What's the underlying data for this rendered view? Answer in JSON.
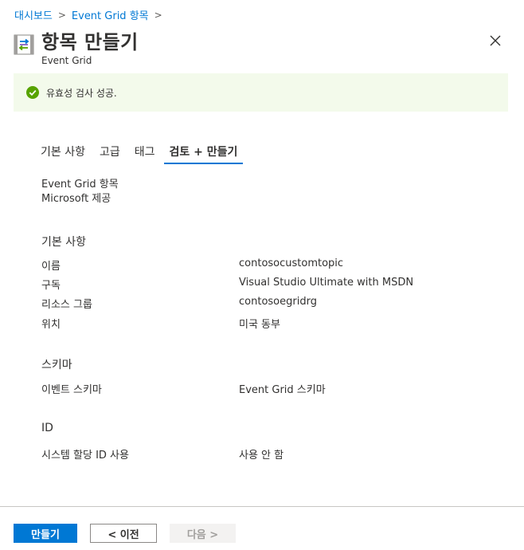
{
  "breadcrumb": {
    "items": [
      "대시보드",
      "Event Grid 항목"
    ],
    "separator": ">"
  },
  "header": {
    "title": "항목 만들기",
    "subtitle": "Event Grid",
    "icon": "event-grid-icon",
    "close_icon": "close-icon"
  },
  "banner": {
    "text": "유효성 검사 성공.",
    "icon": "success-check-icon",
    "color": "#57a300",
    "background": "#f3faeb"
  },
  "tabs": [
    {
      "label": "기본 사항",
      "active": false
    },
    {
      "label": "고급",
      "active": false
    },
    {
      "label": "태그",
      "active": false
    },
    {
      "label": "검토 + 만들기",
      "active": true
    }
  ],
  "summary": {
    "product": "Event Grid 항목",
    "publisher": "Microsoft 제공"
  },
  "sections": {
    "basics": {
      "title": "기본 사항",
      "rows": [
        {
          "key": "이름",
          "value": "contosocustomtopic"
        },
        {
          "key": "구독",
          "value": "Visual Studio Ultimate with MSDN"
        },
        {
          "key": "리소스 그룹",
          "value": "contosoegridrg"
        },
        {
          "key": "위치",
          "value": "미국 동부"
        }
      ]
    },
    "schema": {
      "title": "스키마",
      "rows": [
        {
          "key": "이벤트 스키마",
          "value": "Event Grid 스키마"
        }
      ]
    },
    "identity": {
      "title": "ID",
      "rows": [
        {
          "key": "시스템 할당 ID 사용",
          "value": "사용 안 함"
        }
      ]
    }
  },
  "footer": {
    "create_label": "만들기",
    "previous_label": "< 이전",
    "next_label": "다음 >",
    "accent": "#0078d4"
  }
}
